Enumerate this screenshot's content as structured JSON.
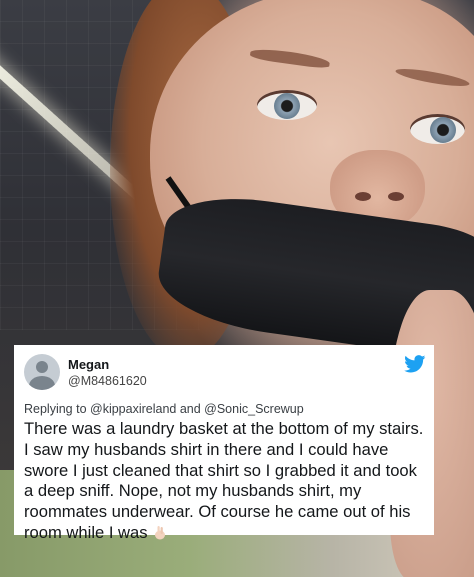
{
  "tweet": {
    "display_name": "Megan",
    "handle": "@M84861620",
    "reply_to": "Replying to @kippaxireland and @Sonic_Screwup",
    "text": "There was a laundry basket at the bottom of my stairs. I saw my husbands shirt in there and I could have swore I just cleaned that shirt so I grabbed it and took a deep sniff. Nope, not my husbands shirt, my roommates underwear. Of course he came out of his room while I was",
    "emoji_icon": "pinching-hand-emoji",
    "avatar_icon": "default-avatar-icon",
    "brand_icon": "twitter-bird-icon"
  },
  "colors": {
    "twitter_blue": "#1da1f2",
    "card_bg": "#ffffff",
    "text": "#14171a"
  }
}
